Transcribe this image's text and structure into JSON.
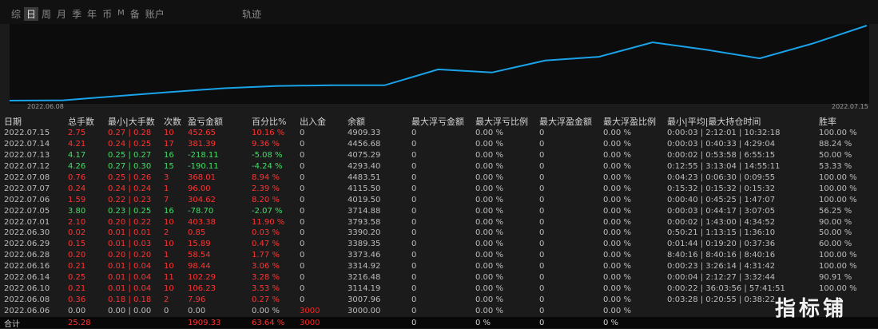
{
  "tabs": [
    "综",
    "日",
    "周",
    "月",
    "季",
    "年",
    "币",
    "M",
    "备",
    "账户"
  ],
  "track_label": "轨迹",
  "chart_data": {
    "type": "line",
    "x": [
      "2022.06.06",
      "2022.06.08",
      "2022.06.10",
      "2022.06.14",
      "2022.06.16",
      "2022.06.28",
      "2022.06.29",
      "2022.06.30",
      "2022.07.01",
      "2022.07.05",
      "2022.07.06",
      "2022.07.07",
      "2022.07.08",
      "2022.07.12",
      "2022.07.13",
      "2022.07.14",
      "2022.07.15"
    ],
    "y": [
      3000.0,
      3007.96,
      3114.19,
      3216.48,
      3314.92,
      3373.46,
      3389.35,
      3390.2,
      3793.58,
      3714.88,
      4019.5,
      4115.5,
      4483.51,
      4293.4,
      4075.29,
      4456.68,
      4909.33
    ],
    "x_tick_labels": [
      "2022.06.08",
      "2022.07.15"
    ],
    "line_color": "#1aa3e8"
  },
  "columns": [
    "日期",
    "总手数",
    "最小|大手数",
    "次数",
    "盈亏金额",
    "百分比%",
    "出入金",
    "余额",
    "最大浮亏金额",
    "最大浮亏比例",
    "最大浮盈金额",
    "最大浮盈比例",
    "最小|平均|最大持仓时间",
    "胜率"
  ],
  "rows": [
    {
      "date": "2022.07.15",
      "lots": "2.75",
      "minmax": "0.27 | 0.28",
      "count": "10",
      "pnl": "452.65",
      "pct": "10.16 %",
      "io": "0",
      "bal": "4909.33",
      "mfl": "0",
      "mflp": "0.00 %",
      "mfp": "0",
      "mfpp": "0.00 %",
      "hold": "0:00:03 | 2:12:01 | 10:32:18",
      "win": "100.00 %",
      "cls": "neg"
    },
    {
      "date": "2022.07.14",
      "lots": "4.21",
      "minmax": "0.24 | 0.25",
      "count": "17",
      "pnl": "381.39",
      "pct": "9.36 %",
      "io": "0",
      "bal": "4456.68",
      "mfl": "0",
      "mflp": "0.00 %",
      "mfp": "0",
      "mfpp": "0.00 %",
      "hold": "0:00:03 | 0:40:33 | 4:29:04",
      "win": "88.24 %",
      "cls": "neg"
    },
    {
      "date": "2022.07.13",
      "lots": "4.17",
      "minmax": "0.25 | 0.27",
      "count": "16",
      "pnl": "-218.11",
      "pct": "-5.08 %",
      "io": "0",
      "bal": "4075.29",
      "mfl": "0",
      "mflp": "0.00 %",
      "mfp": "0",
      "mfpp": "0.00 %",
      "hold": "0:00:02 | 0:53:58 | 6:55:15",
      "win": "50.00 %",
      "cls": "pos"
    },
    {
      "date": "2022.07.12",
      "lots": "4.26",
      "minmax": "0.27 | 0.30",
      "count": "15",
      "pnl": "-190.11",
      "pct": "-4.24 %",
      "io": "0",
      "bal": "4293.40",
      "mfl": "0",
      "mflp": "0.00 %",
      "mfp": "0",
      "mfpp": "0.00 %",
      "hold": "0:12:55 | 3:13:04 | 14:55:11",
      "win": "53.33 %",
      "cls": "pos"
    },
    {
      "date": "2022.07.08",
      "lots": "0.76",
      "minmax": "0.25 | 0.26",
      "count": "3",
      "pnl": "368.01",
      "pct": "8.94 %",
      "io": "0",
      "bal": "4483.51",
      "mfl": "0",
      "mflp": "0.00 %",
      "mfp": "0",
      "mfpp": "0.00 %",
      "hold": "0:04:23 | 0:06:30 | 0:09:55",
      "win": "100.00 %",
      "cls": "neg"
    },
    {
      "date": "2022.07.07",
      "lots": "0.24",
      "minmax": "0.24 | 0.24",
      "count": "1",
      "pnl": "96.00",
      "pct": "2.39 %",
      "io": "0",
      "bal": "4115.50",
      "mfl": "0",
      "mflp": "0.00 %",
      "mfp": "0",
      "mfpp": "0.00 %",
      "hold": "0:15:32 | 0:15:32 | 0:15:32",
      "win": "100.00 %",
      "cls": "neg"
    },
    {
      "date": "2022.07.06",
      "lots": "1.59",
      "minmax": "0.22 | 0.23",
      "count": "7",
      "pnl": "304.62",
      "pct": "8.20 %",
      "io": "0",
      "bal": "4019.50",
      "mfl": "0",
      "mflp": "0.00 %",
      "mfp": "0",
      "mfpp": "0.00 %",
      "hold": "0:00:40 | 0:45:25 | 1:47:07",
      "win": "100.00 %",
      "cls": "neg"
    },
    {
      "date": "2022.07.05",
      "lots": "3.80",
      "minmax": "0.23 | 0.25",
      "count": "16",
      "pnl": "-78.70",
      "pct": "-2.07 %",
      "io": "0",
      "bal": "3714.88",
      "mfl": "0",
      "mflp": "0.00 %",
      "mfp": "0",
      "mfpp": "0.00 %",
      "hold": "0:00:03 | 0:44:17 | 3:07:05",
      "win": "56.25 %",
      "cls": "pos"
    },
    {
      "date": "2022.07.01",
      "lots": "2.10",
      "minmax": "0.20 | 0.22",
      "count": "10",
      "pnl": "403.38",
      "pct": "11.90 %",
      "io": "0",
      "bal": "3793.58",
      "mfl": "0",
      "mflp": "0.00 %",
      "mfp": "0",
      "mfpp": "0.00 %",
      "hold": "0:00:02 | 1:43:00 | 4:34:52",
      "win": "90.00 %",
      "cls": "neg"
    },
    {
      "date": "2022.06.30",
      "lots": "0.02",
      "minmax": "0.01 | 0.01",
      "count": "2",
      "pnl": "0.85",
      "pct": "0.03 %",
      "io": "0",
      "bal": "3390.20",
      "mfl": "0",
      "mflp": "0.00 %",
      "mfp": "0",
      "mfpp": "0.00 %",
      "hold": "0:50:21 | 1:13:15 | 1:36:10",
      "win": "50.00 %",
      "cls": "neg"
    },
    {
      "date": "2022.06.29",
      "lots": "0.15",
      "minmax": "0.01 | 0.03",
      "count": "10",
      "pnl": "15.89",
      "pct": "0.47 %",
      "io": "0",
      "bal": "3389.35",
      "mfl": "0",
      "mflp": "0.00 %",
      "mfp": "0",
      "mfpp": "0.00 %",
      "hold": "0:01:44 | 0:19:20 | 0:37:36",
      "win": "60.00 %",
      "cls": "neg"
    },
    {
      "date": "2022.06.28",
      "lots": "0.20",
      "minmax": "0.20 | 0.20",
      "count": "1",
      "pnl": "58.54",
      "pct": "1.77 %",
      "io": "0",
      "bal": "3373.46",
      "mfl": "0",
      "mflp": "0.00 %",
      "mfp": "0",
      "mfpp": "0.00 %",
      "hold": "8:40:16 | 8:40:16 | 8:40:16",
      "win": "100.00 %",
      "cls": "neg"
    },
    {
      "date": "2022.06.16",
      "lots": "0.21",
      "minmax": "0.01 | 0.04",
      "count": "10",
      "pnl": "98.44",
      "pct": "3.06 %",
      "io": "0",
      "bal": "3314.92",
      "mfl": "0",
      "mflp": "0.00 %",
      "mfp": "0",
      "mfpp": "0.00 %",
      "hold": "0:00:23 | 3:26:14 | 4:31:42",
      "win": "100.00 %",
      "cls": "neg"
    },
    {
      "date": "2022.06.14",
      "lots": "0.25",
      "minmax": "0.01 | 0.04",
      "count": "11",
      "pnl": "102.29",
      "pct": "3.28 %",
      "io": "0",
      "bal": "3216.48",
      "mfl": "0",
      "mflp": "0.00 %",
      "mfp": "0",
      "mfpp": "0.00 %",
      "hold": "0:00:04 | 2:12:27 | 3:32:44",
      "win": "90.91 %",
      "cls": "neg"
    },
    {
      "date": "2022.06.10",
      "lots": "0.21",
      "minmax": "0.01 | 0.04",
      "count": "10",
      "pnl": "106.23",
      "pct": "3.53 %",
      "io": "0",
      "bal": "3114.19",
      "mfl": "0",
      "mflp": "0.00 %",
      "mfp": "0",
      "mfpp": "0.00 %",
      "hold": "0:00:22 | 36:03:56 | 57:41:51",
      "win": "100.00 %",
      "cls": "neg"
    },
    {
      "date": "2022.06.08",
      "lots": "0.36",
      "minmax": "0.18 | 0.18",
      "count": "2",
      "pnl": "7.96",
      "pct": "0.27 %",
      "io": "0",
      "bal": "3007.96",
      "mfl": "0",
      "mflp": "0.00 %",
      "mfp": "0",
      "mfpp": "0.00 %",
      "hold": "0:03:28 | 0:20:55 | 0:38:22",
      "win": "",
      "cls": "neg"
    },
    {
      "date": "2022.06.06",
      "lots": "0.00",
      "minmax": "0.00 | 0.00",
      "count": "0",
      "pnl": "0.00",
      "pct": "0.00 %",
      "io": "3000",
      "bal": "3000.00",
      "mfl": "0",
      "mflp": "0.00 %",
      "mfp": "0",
      "mfpp": "0.00 %",
      "hold": "",
      "win": "",
      "cls": "zero"
    }
  ],
  "total": {
    "label": "合计",
    "lots": "25.28",
    "pnl": "1909.33",
    "pct": "63.64 %",
    "io": "3000",
    "mfl": "0",
    "mflp": "0 %",
    "mfp": "0",
    "mfpp": "0 %"
  },
  "logo": "指标铺"
}
